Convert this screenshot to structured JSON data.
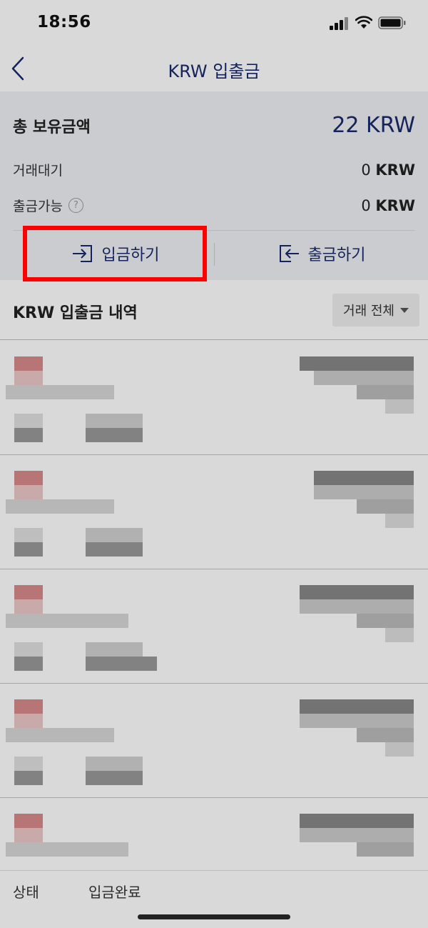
{
  "status_bar": {
    "time": "18:56"
  },
  "nav": {
    "title": "KRW 입출금"
  },
  "balance": {
    "total_label": "총 보유금액",
    "total_value": "22 KRW",
    "pending_label": "거래대기",
    "pending_amount": "0",
    "pending_unit": "KRW",
    "withdrawable_label": "출금가능",
    "help_symbol": "?",
    "withdrawable_amount": "0",
    "withdrawable_unit": "KRW"
  },
  "actions": {
    "deposit_label": "입금하기",
    "withdraw_label": "출금하기"
  },
  "history": {
    "title": "KRW 입출금 내역",
    "filter_label": "거래 전체"
  },
  "footer_row": {
    "status_label": "상태",
    "status_value": "입금완료"
  },
  "colors": {
    "accent": "#1a2a6c",
    "highlight": "#ff0000",
    "panel_bg": "#eef0f5"
  },
  "icons": [
    "signal-icon",
    "wifi-icon",
    "battery-icon",
    "back-icon",
    "deposit-icon",
    "withdraw-icon",
    "help-icon",
    "caret-down-icon"
  ]
}
